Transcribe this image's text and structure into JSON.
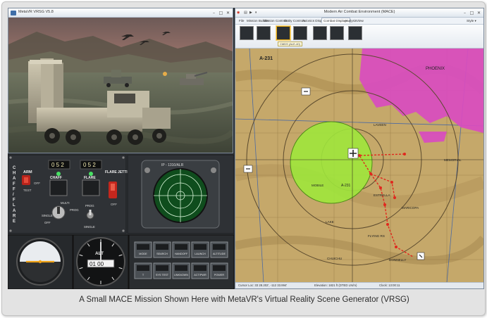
{
  "caption": "A Small MACE Mission Shown Here with MetaVR's Virtual Reality Scene Generator (VRSG)",
  "vrsg": {
    "window_title": "MetaVR VRSG V5.8"
  },
  "cockpit": {
    "chaff_count": "0 5 2",
    "flare_count": "0 5 2",
    "arm_label": "ARM",
    "off_label": "OFF",
    "test_label": "TEST",
    "side_label": [
      "C",
      "H",
      "A",
      "F",
      "F",
      "/",
      "F",
      "L",
      "A",
      "R",
      "E"
    ],
    "chaff_label": "CHAFF",
    "flare_label": "FLARE",
    "flare_jettison_label": "FLARE JETTISON",
    "off2_label": "OFF",
    "single_label": "SINGLE",
    "multi_label": "MULTI",
    "prog_label": "PROG",
    "off3_label": "OFF",
    "prog2_label": "PROG",
    "single2_label": "SINGLE",
    "rwr_title": "IP - 1310/ALR",
    "alt_label": "ALT",
    "alt_value": "01 00",
    "buttons": [
      {
        "label": "MODE"
      },
      {
        "label": "SEARCH"
      },
      {
        "label": "HANDOFF"
      },
      {
        "label": "LAUNCH"
      },
      {
        "label": "ALTITUDE"
      },
      {
        "label": "T"
      },
      {
        "label": "SYS TEST"
      },
      {
        "label": "UNKNOWN"
      },
      {
        "label": "ACT/PWR"
      },
      {
        "label": "POWER"
      }
    ]
  },
  "mace": {
    "window_title": "Modern Air Combat Environment (MACE)",
    "tabs": [
      {
        "label": "File"
      },
      {
        "label": "Mission Builder"
      },
      {
        "label": "Mission Controls"
      },
      {
        "label": "Entity Controls"
      },
      {
        "label": "Avionics Displays"
      },
      {
        "label": "Combat Displays"
      },
      {
        "label": "Analysis"
      },
      {
        "label": "View"
      }
    ],
    "style_label": "Style",
    "ribbon_tooltip": "CMDS (ALE-40)",
    "map_labels": {
      "a231": "A-231",
      "a231c": "A-231",
      "memorial": "MEMORIAL",
      "mobile": "MOBILE",
      "lake": "LAKE",
      "flying_rs": "FLYING RS",
      "chuichu": "CHUICHU",
      "donnelly": "DONNELLY",
      "estrella": "ESTRELLA",
      "maricopa": "MARICOPA",
      "laveen": "LAVEEN",
      "phoenix": "PHOENIX"
    },
    "status": {
      "cursor": "Cursor Loc: 33 28.202', -112 33.994'",
      "elevation": "Elevation: 1821 ft (DTED LN/m)",
      "clock": "Clock: 13:00:11"
    }
  },
  "colors": {
    "zone_fill": "#9fe53c",
    "route": "#e0281e",
    "urban": "#d94cc0",
    "map_base": "#c5a86a"
  }
}
